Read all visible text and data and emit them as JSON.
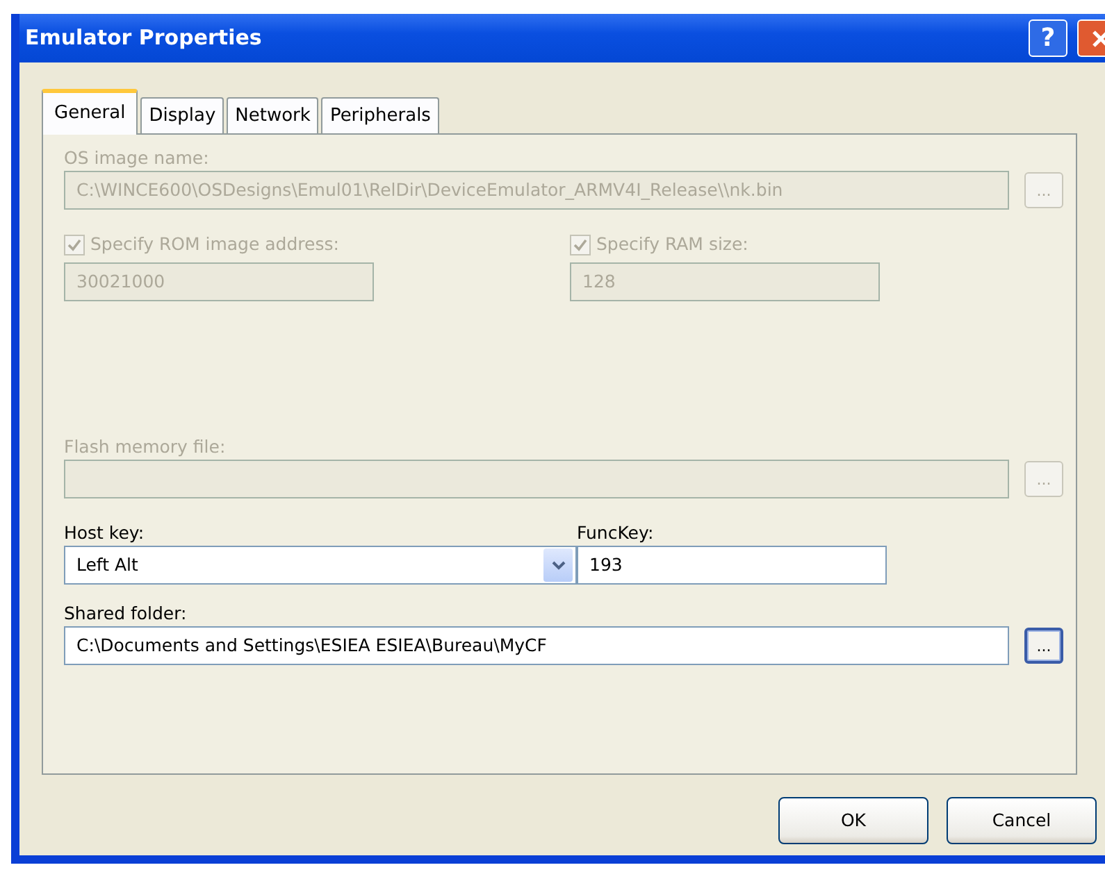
{
  "window": {
    "title": "Emulator Properties",
    "help_button": "?"
  },
  "tabs": [
    {
      "label": "General",
      "selected": true
    },
    {
      "label": "Display",
      "selected": false
    },
    {
      "label": "Network",
      "selected": false
    },
    {
      "label": "Peripherals",
      "selected": false
    }
  ],
  "rows": [
    {
      "kind": "file",
      "label": "OS image name:",
      "value": "C:\\WINCE600\\OSDesigns\\Emul01\\RelDir\\DeviceEmulator_ARMV4I_Release\\\\nk.bin",
      "disabled": true,
      "browse": "...",
      "focused": false
    },
    {
      "kind": "pair",
      "items": [
        {
          "kind": "checkfield",
          "label": "Specify ROM image address:",
          "checked": true,
          "disabled": true,
          "value": "30021000"
        },
        {
          "kind": "checkfield",
          "label": "Specify RAM size:",
          "checked": true,
          "disabled": true,
          "value": "128"
        }
      ]
    },
    {
      "kind": "file",
      "label": "Flash memory file:",
      "disabled": true,
      "browse": "...",
      "focused": false
    },
    {
      "kind": "pair",
      "items": [
        {
          "kind": "select",
          "label": "Host key:",
          "disabled": false,
          "value": "Left Alt"
        },
        {
          "kind": "text",
          "label": "FuncKey:",
          "disabled": false,
          "value": "193"
        }
      ]
    },
    {
      "kind": "file",
      "label": "Shared folder:",
      "value": "C:\\Documents and Settings\\ESIEA ESIEA\\Bureau\\MyCF",
      "disabled": false,
      "browse": "...",
      "focused": true
    }
  ],
  "buttons": [
    "OK",
    "Cancel"
  ]
}
